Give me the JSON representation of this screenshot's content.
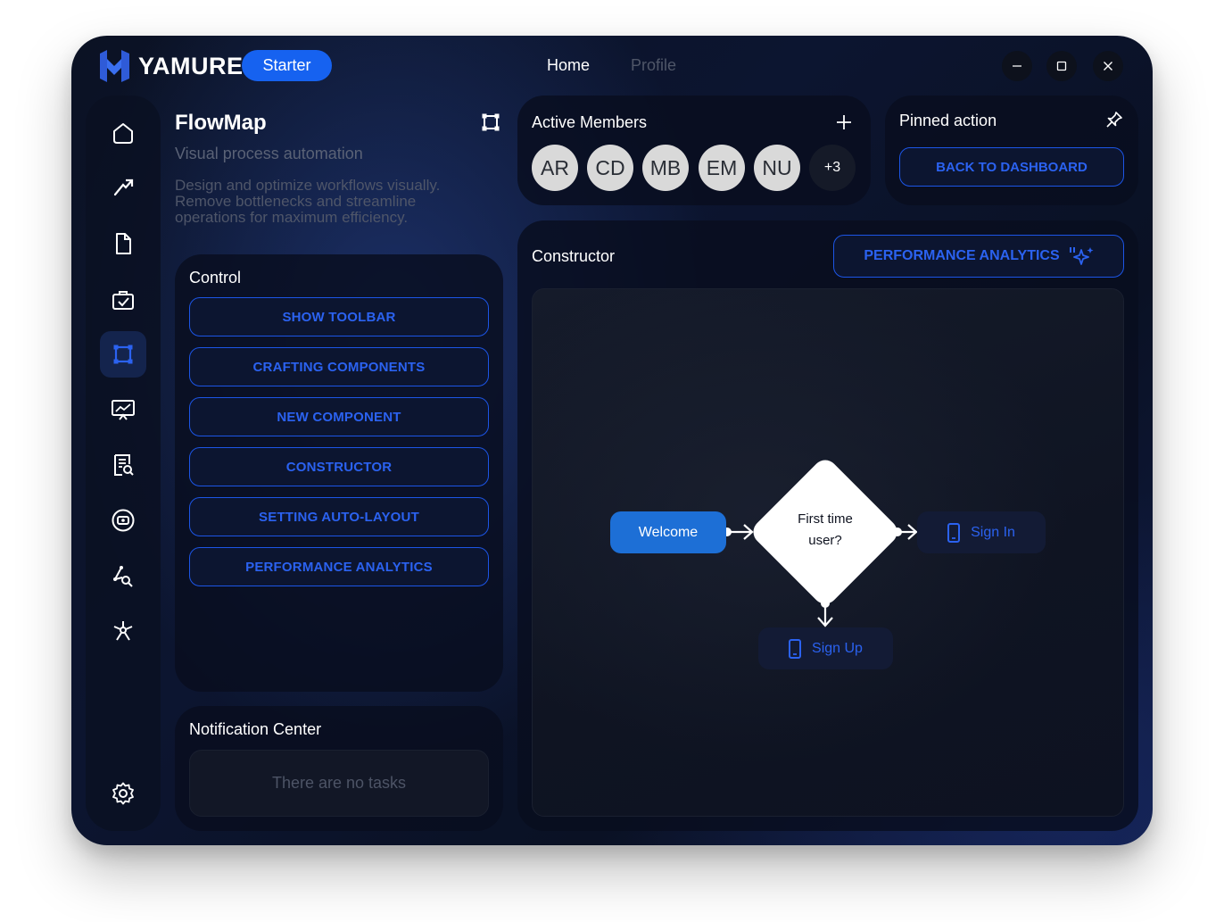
{
  "app": {
    "logo_text": "YAMURE",
    "plan_badge": "Starter"
  },
  "nav": {
    "home": "Home",
    "profile": "Profile"
  },
  "sidebar": {
    "items": [
      {
        "icon": "home-icon"
      },
      {
        "icon": "pen-tool-icon"
      },
      {
        "icon": "document-icon"
      },
      {
        "icon": "task-check-icon"
      },
      {
        "icon": "frame-icon",
        "active": true
      },
      {
        "icon": "presentation-icon"
      },
      {
        "icon": "report-search-icon"
      },
      {
        "icon": "circle-toggle-icon"
      },
      {
        "icon": "vector-edit-icon"
      },
      {
        "icon": "network-icon"
      }
    ],
    "settings_icon": "gear-icon"
  },
  "flowmap": {
    "title": "FlowMap",
    "subtitle": "Visual process automation",
    "description": "Design and optimize workflows visually. Remove bottlenecks and streamline operations for maximum efficiency."
  },
  "control": {
    "title": "Control",
    "buttons": [
      "SHOW TOOLBAR",
      "CRAFTING COMPONENTS",
      "NEW COMPONENT",
      "CONSTRUCTOR",
      "SETTING AUTO-LAYOUT",
      "PERFORMANCE ANALYTICS"
    ]
  },
  "notifications": {
    "title": "Notification Center",
    "empty_text": "There are no tasks"
  },
  "members": {
    "title": "Active Members",
    "avatars": [
      "AR",
      "CD",
      "MB",
      "EM",
      "NU"
    ],
    "more": "+3"
  },
  "pinned": {
    "title": "Pinned action",
    "button": "BACK TO DASHBOARD"
  },
  "constructor": {
    "title": "Constructor",
    "analytics_button": "PERFORMANCE ANALYTICS",
    "nodes": {
      "welcome": "Welcome",
      "decision_line1": "First time",
      "decision_line2": "user?",
      "sign_in": "Sign In",
      "sign_up": "Sign Up"
    }
  },
  "colors": {
    "accent": "#1662f0",
    "button_text": "#2b62f0",
    "welcome_node": "#1d6fd6"
  }
}
